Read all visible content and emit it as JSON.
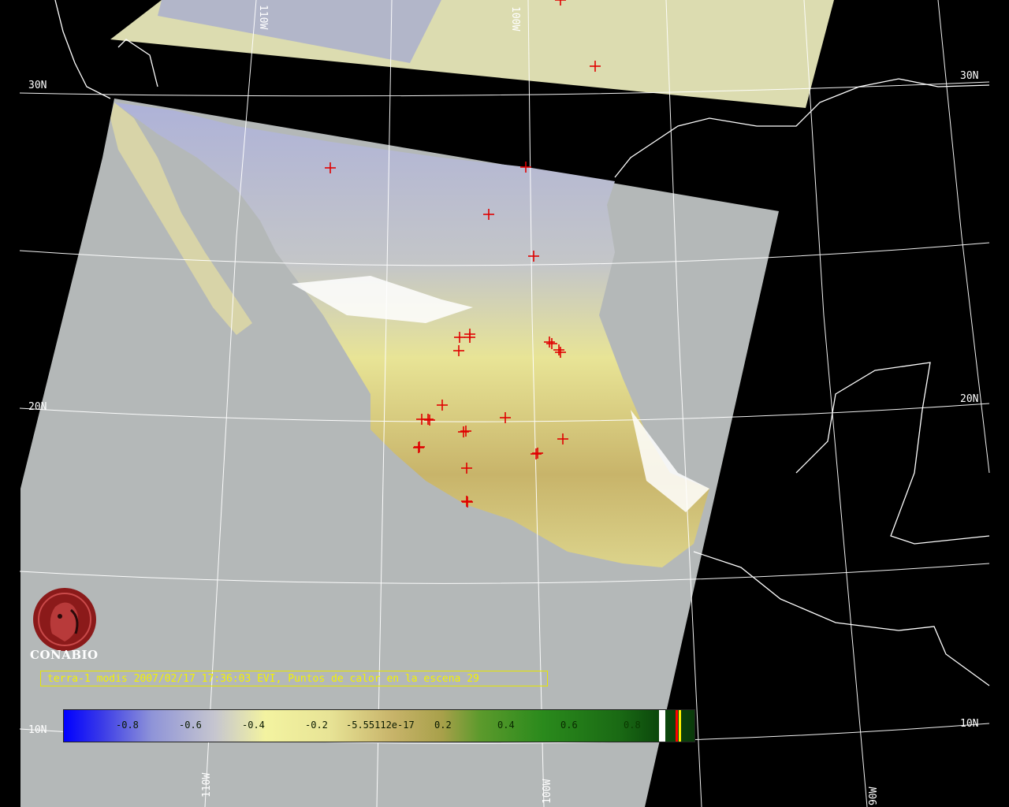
{
  "map": {
    "title_text": "terra-1 modis 2007/02/17 17:36:03 EVI, Puntos de calor en la escena 29",
    "organization": "CONABIO",
    "grid_labels": {
      "lat_30_left": "30N",
      "lat_30_right": "30N",
      "lat_20_left": "20N",
      "lat_20_right": "20N",
      "lat_10_left": "10N",
      "lat_10_right": "10N",
      "lon_110_top": "110W",
      "lon_100_top": "100W",
      "lon_110_bottom": "110W",
      "lon_100_bottom": "100W",
      "lon_90_bottom": "90W"
    },
    "hotspot_count_label": "29",
    "colors": {
      "background": "#000000",
      "no_data": "#b4b8b8",
      "hotspot": "#e00000",
      "title_text": "#f2f200",
      "logo": "#8b1a1a"
    }
  },
  "legend": {
    "ticks": [
      "-0.8",
      "-0.6",
      "-0.4",
      "-0.2",
      "-5.55112e-17",
      "0.2",
      "0.4",
      "0.6",
      "0.8"
    ],
    "extra_swatches": [
      "white",
      "red",
      "yellow"
    ]
  }
}
